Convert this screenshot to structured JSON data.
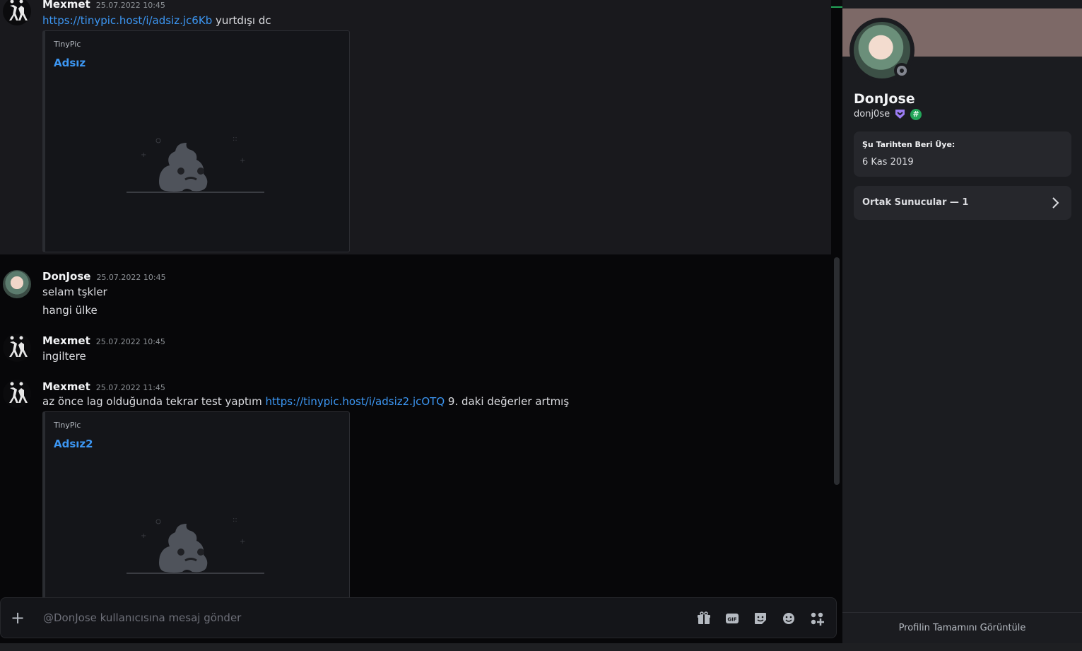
{
  "messages": [
    {
      "author": "Mexmet",
      "timestamp": "25.07.2022 10:45",
      "link": "https://tinypic.host/i/adsiz.jc6Kb",
      "text_after": "yurtdışı dc",
      "embed": {
        "provider": "TinyPic",
        "title": "Adsız"
      }
    },
    {
      "author": "DonJose",
      "timestamp": "25.07.2022 10:45",
      "lines": [
        "selam tşkler",
        "hangi ülke"
      ]
    },
    {
      "author": "Mexmet",
      "timestamp": "25.07.2022 10:45",
      "text": "ingiltere"
    },
    {
      "author": "Mexmet",
      "timestamp": "25.07.2022 11:45",
      "text_before": "az önce lag olduğunda tekrar test yaptım",
      "link": "https://tinypic.host/i/adsiz2.jcOTQ",
      "text_after": "9. daki değerler artmış",
      "embed": {
        "provider": "TinyPic",
        "title": "Adsız2"
      }
    }
  ],
  "composer": {
    "placeholder": "@DonJose kullanıcısına mesaj gönder",
    "icons": [
      "plus-icon",
      "gift-icon",
      "gif-icon",
      "sticker-icon",
      "emoji-icon",
      "apps-icon"
    ]
  },
  "profile": {
    "display_name": "DonJose",
    "username": "donj0se",
    "member_since_label": "Şu Tarihten Beri Üye:",
    "member_since_value": "6 Kas 2019",
    "mutual_servers": "Ortak Sunucular — 1",
    "view_full_profile": "Profilin Tamamını Görüntüle",
    "status": "offline"
  },
  "colors": {
    "link": "#3c96f2",
    "online_green": "#23a559",
    "banner": "#7d6967"
  }
}
